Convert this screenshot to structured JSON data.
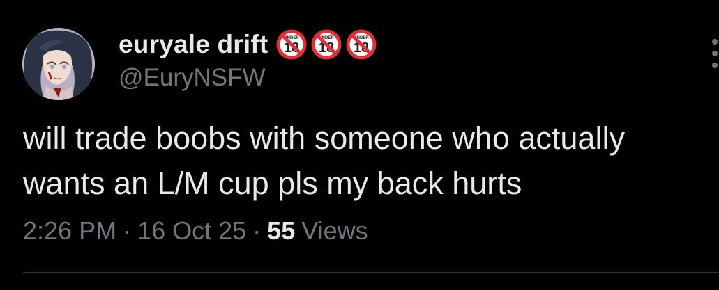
{
  "author": {
    "display_name": "euryale drift",
    "handle": "@EuryNSFW",
    "avatar_icon": "profile-avatar",
    "badges": [
      {
        "icon": "under-18-prohibited-icon",
        "top_text": "UNDER",
        "number": "18"
      },
      {
        "icon": "under-18-prohibited-icon",
        "top_text": "UNDER",
        "number": "18"
      },
      {
        "icon": "under-18-prohibited-icon",
        "top_text": "UNDER",
        "number": "18"
      }
    ]
  },
  "tweet": {
    "lines": [
      "will trade boobs with someone who actually",
      "wants an L/M cup pls my back hurts"
    ]
  },
  "meta": {
    "time": "2:26 PM",
    "separator": "·",
    "date": "16 Oct 25",
    "views_count": "55",
    "views_label": "Views"
  },
  "colors": {
    "background": "#000000",
    "primary_text": "#e7e9ea",
    "secondary_text": "#71767b",
    "divider": "#2f3336",
    "badge_red": "#e0303a"
  }
}
